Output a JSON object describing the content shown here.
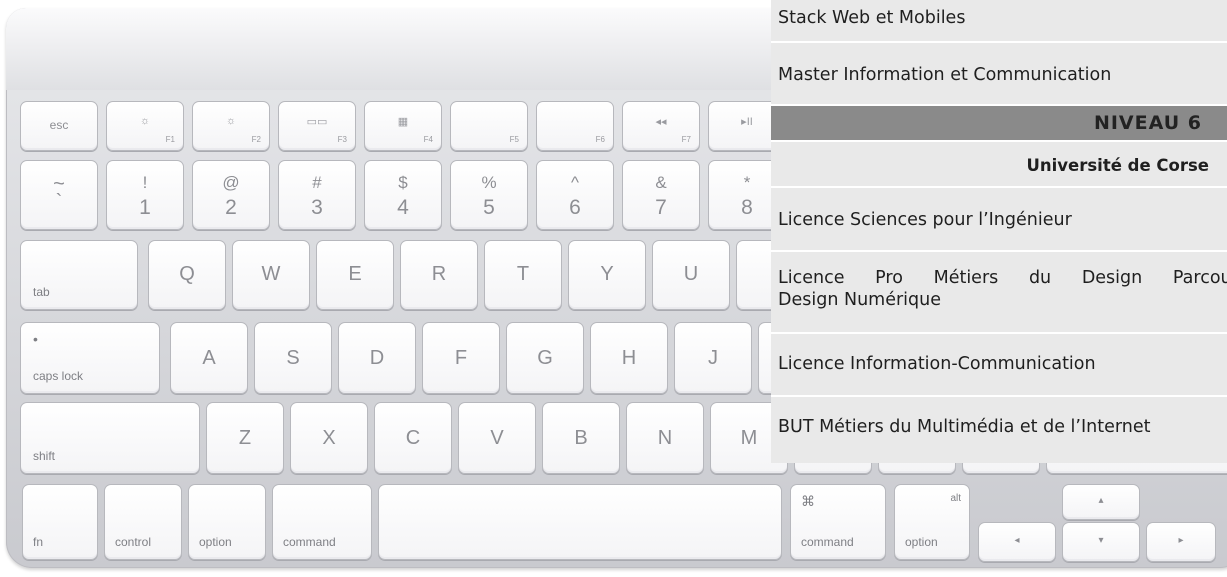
{
  "keyboard": {
    "function_row": [
      {
        "name": "esc",
        "label": "esc",
        "fn": ""
      },
      {
        "name": "f1",
        "label": "",
        "fn": "F1",
        "symbol": "☼"
      },
      {
        "name": "f2",
        "label": "",
        "fn": "F2",
        "symbol": "☼"
      },
      {
        "name": "f3",
        "label": "",
        "fn": "F3",
        "symbol": "▭▭"
      },
      {
        "name": "f4",
        "label": "",
        "fn": "F4",
        "symbol": "▦"
      },
      {
        "name": "f5",
        "label": "",
        "fn": "F5",
        "symbol": ""
      },
      {
        "name": "f6",
        "label": "",
        "fn": "F6",
        "symbol": ""
      },
      {
        "name": "f7",
        "label": "",
        "fn": "F7",
        "symbol": "◂◂"
      },
      {
        "name": "f8",
        "label": "",
        "fn": "",
        "symbol": "▸II"
      }
    ],
    "number_row": [
      {
        "name": "tilde",
        "top": "~",
        "bottom": "`"
      },
      {
        "name": "1",
        "top": "!",
        "bottom": "1"
      },
      {
        "name": "2",
        "top": "@",
        "bottom": "2"
      },
      {
        "name": "3",
        "top": "#",
        "bottom": "3"
      },
      {
        "name": "4",
        "top": "$",
        "bottom": "4"
      },
      {
        "name": "5",
        "top": "%",
        "bottom": "5"
      },
      {
        "name": "6",
        "top": "^",
        "bottom": "6"
      },
      {
        "name": "7",
        "top": "&",
        "bottom": "7"
      },
      {
        "name": "8",
        "top": "*",
        "bottom": "8"
      }
    ],
    "tab_label": "tab",
    "qwerty": [
      "Q",
      "W",
      "E",
      "R",
      "T",
      "Y",
      "U"
    ],
    "caps_label": "caps lock",
    "caps_dot": "•",
    "home_row": [
      "A",
      "S",
      "D",
      "F",
      "G",
      "H",
      "J"
    ],
    "shift_label": "shift",
    "bottom_letters": [
      "Z",
      "X",
      "C",
      "V",
      "B",
      "N",
      "M"
    ],
    "fn_label": "fn",
    "control_label": "control",
    "option_label": "option",
    "command_label": "command",
    "right_command_label": "command",
    "right_command_symbol": "⌘",
    "right_option_label": "option",
    "right_option_alt": "alt",
    "arrow_up": "▴",
    "arrow_down": "▾",
    "arrow_left": "◂",
    "arrow_right": "▸"
  },
  "menu": {
    "items": [
      "Stack Web et Mobiles",
      "Master Information et Communication"
    ],
    "level_heading": "NIVEAU 6",
    "university": "Université de Corse",
    "items2": [
      "Licence Sciences pour l’Ingénieur"
    ],
    "licence_pro_words": [
      "Licence",
      "Pro",
      "Métiers",
      "du",
      "Design",
      "Parcours"
    ],
    "licence_pro_line2": "Design Numérique",
    "items3": [
      "Licence Information-Communication",
      "BUT Métiers du Multimédia et de l’Internet"
    ]
  }
}
